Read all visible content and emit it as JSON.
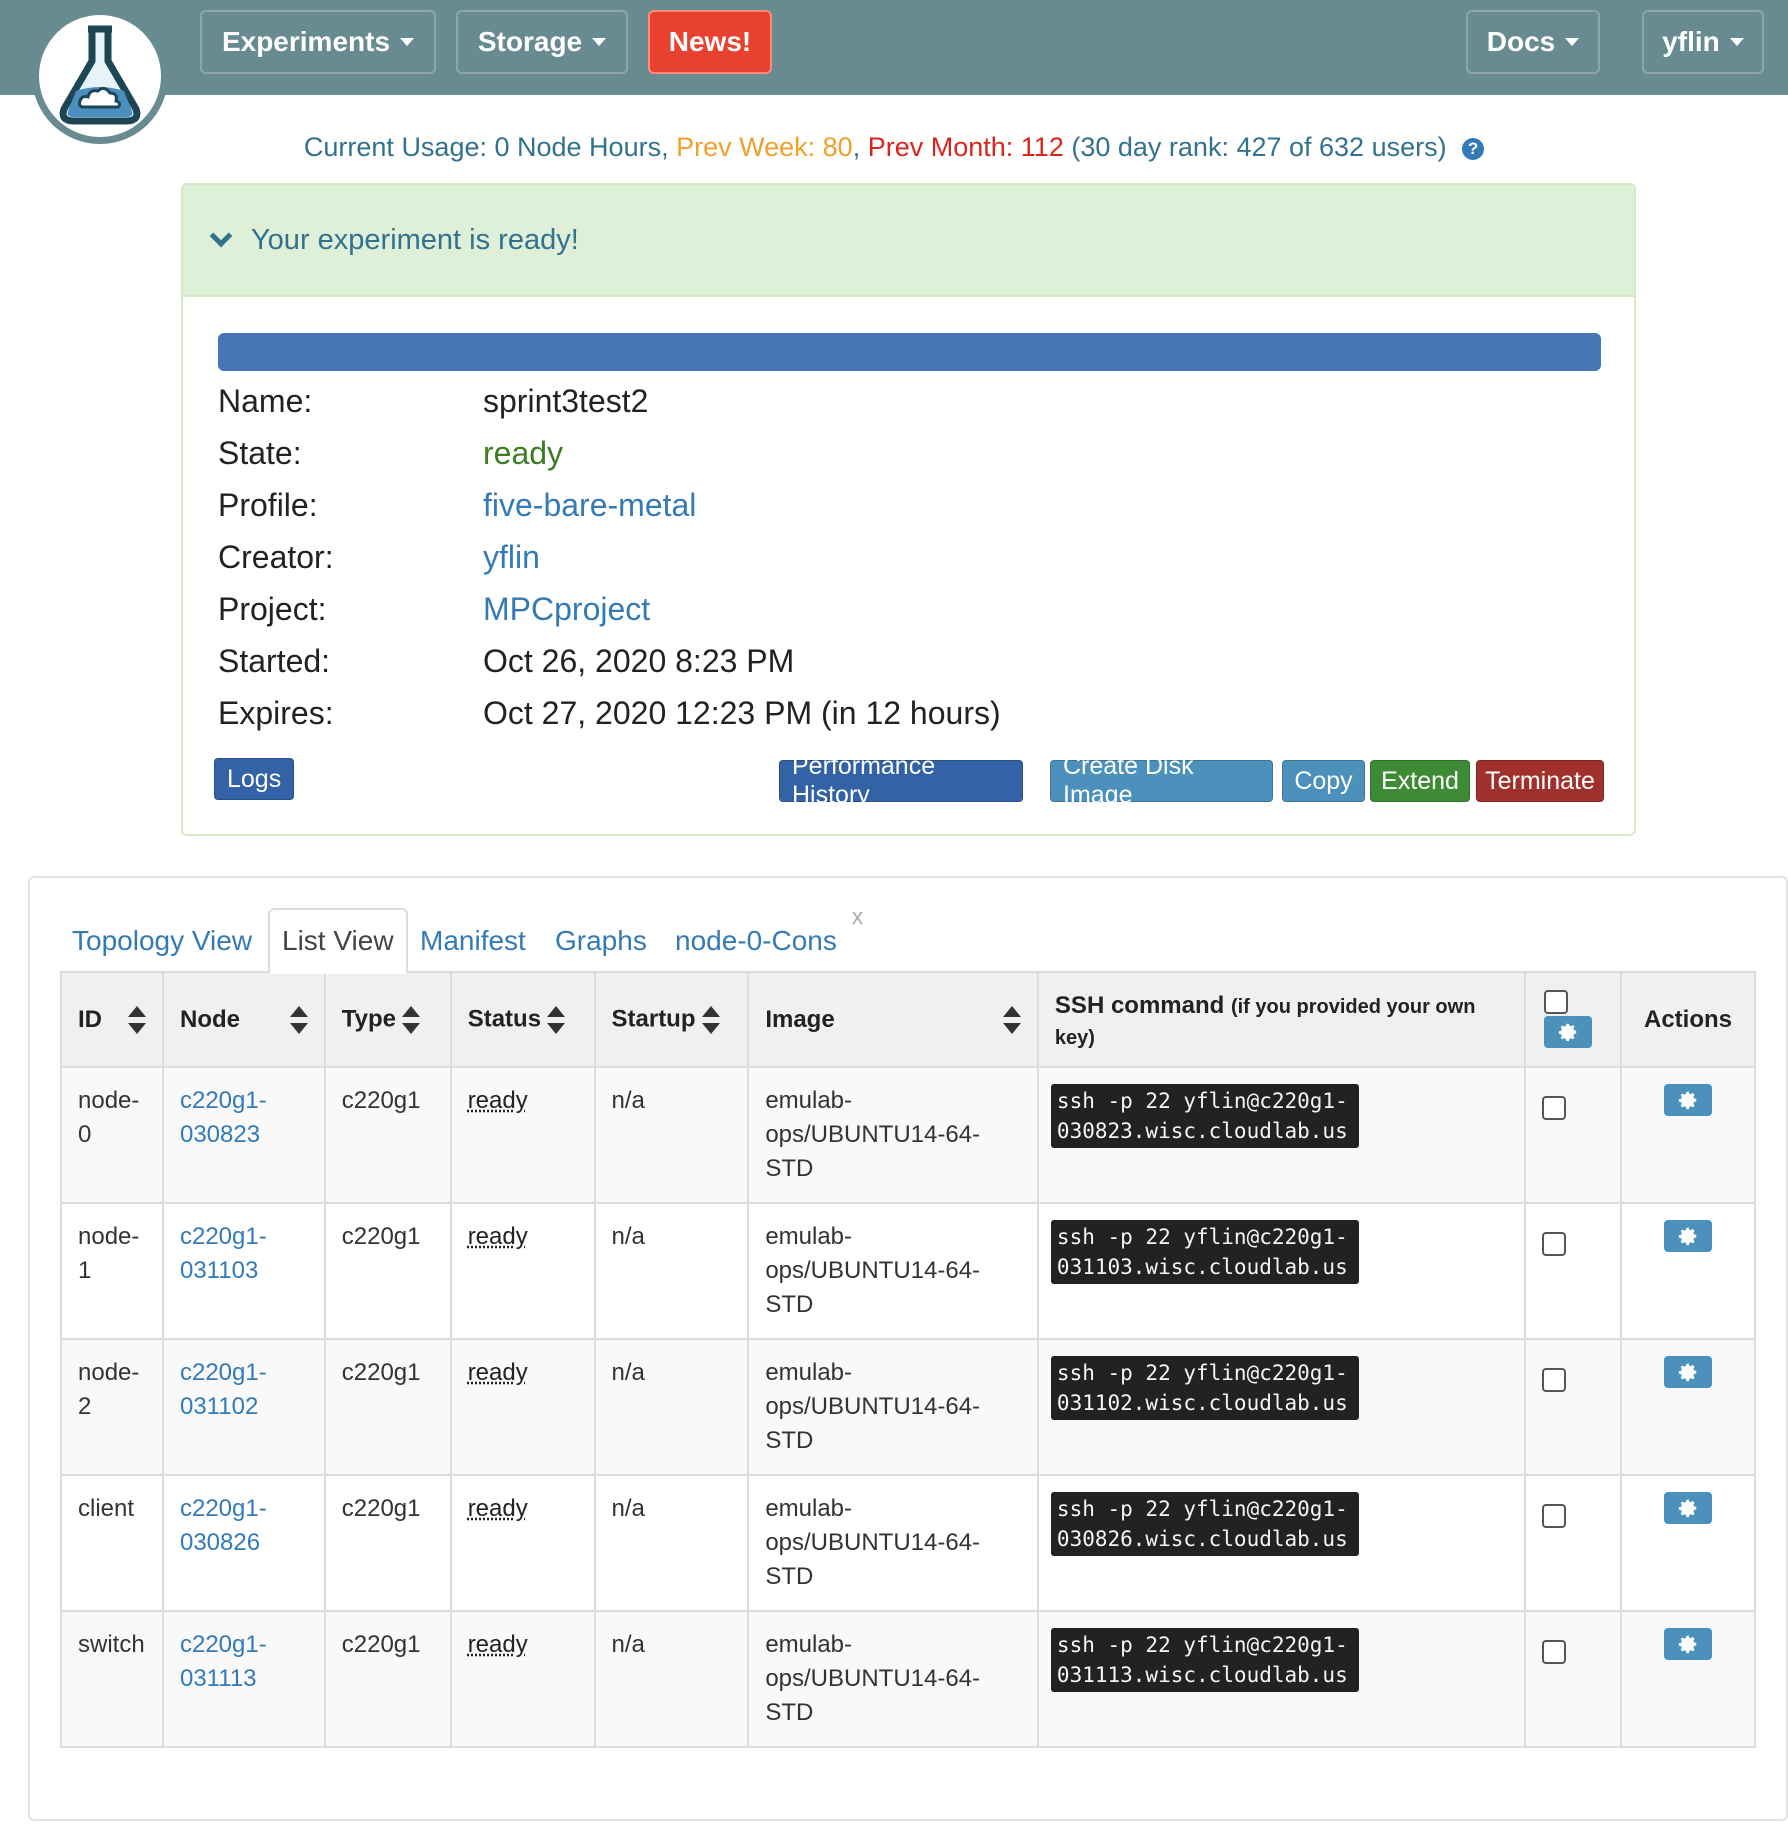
{
  "nav": {
    "experiments": "Experiments",
    "storage": "Storage",
    "news": "News!",
    "docs": "Docs",
    "user": "yflin"
  },
  "usage": {
    "current": "Current Usage: 0 Node Hours",
    "sep1": ",",
    "prev_week": "Prev Week: 80",
    "sep2": ",",
    "prev_month": "Prev Month: 112",
    "rank": "(30 day rank: 427 of 632 users)"
  },
  "panel": {
    "heading": "Your experiment is ready!",
    "progress_percent": 100,
    "fields": [
      {
        "label": "Name:",
        "value": "sprint3test2"
      },
      {
        "label": "State:",
        "value": "ready"
      },
      {
        "label": "Profile:",
        "value": "five-bare-metal"
      },
      {
        "label": "Creator:",
        "value": "yflin"
      },
      {
        "label": "Project:",
        "value": "MPCproject"
      },
      {
        "label": "Started:",
        "value": "Oct 26, 2020 8:23 PM"
      },
      {
        "label": "Expires:",
        "value": "Oct 27, 2020 12:23 PM (in 12 hours)"
      }
    ],
    "buttons": {
      "logs": "Logs",
      "performance": "Performance History",
      "create_disk_image": "Create Disk Image",
      "copy": "Copy",
      "extend": "Extend",
      "terminate": "Terminate"
    }
  },
  "tabs": [
    {
      "label": "Topology View"
    },
    {
      "label": "List View"
    },
    {
      "label": "Manifest"
    },
    {
      "label": "Graphs"
    },
    {
      "label": "node-0-Cons",
      "close": "x"
    }
  ],
  "table": {
    "headers": {
      "id": "ID",
      "node": "Node",
      "type": "Type",
      "status": "Status",
      "startup": "Startup",
      "image": "Image",
      "ssh": "SSH command",
      "ssh_note": "(if you provided your own key)",
      "actions": "Actions"
    },
    "rows": [
      {
        "id": "node-0",
        "node": "c220g1-030823",
        "type": "c220g1",
        "status": "ready",
        "startup": "n/a",
        "image": "emulab-ops/UBUNTU14-64-STD",
        "ssh": "ssh -p 22 yflin@c220g1-030823.wisc.cloudlab.us"
      },
      {
        "id": "node-1",
        "node": "c220g1-031103",
        "type": "c220g1",
        "status": "ready",
        "startup": "n/a",
        "image": "emulab-ops/UBUNTU14-64-STD",
        "ssh": "ssh -p 22 yflin@c220g1-031103.wisc.cloudlab.us"
      },
      {
        "id": "node-2",
        "node": "c220g1-031102",
        "type": "c220g1",
        "status": "ready",
        "startup": "n/a",
        "image": "emulab-ops/UBUNTU14-64-STD",
        "ssh": "ssh -p 22 yflin@c220g1-031102.wisc.cloudlab.us"
      },
      {
        "id": "client",
        "node": "c220g1-030826",
        "type": "c220g1",
        "status": "ready",
        "startup": "n/a",
        "image": "emulab-ops/UBUNTU14-64-STD",
        "ssh": "ssh -p 22 yflin@c220g1-030826.wisc.cloudlab.us"
      },
      {
        "id": "switch",
        "node": "c220g1-031113",
        "type": "c220g1",
        "status": "ready",
        "startup": "n/a",
        "image": "emulab-ops/UBUNTU14-64-STD",
        "ssh": "ssh -p 22 yflin@c220g1-031113.wisc.cloudlab.us"
      }
    ]
  },
  "colors": {
    "nav_bg": "#688b91",
    "news_bg": "#e8412f",
    "link": "#337ab7",
    "ready_green": "#3a7d22",
    "prev_week": "#f0a02a",
    "prev_month": "#d9261c",
    "progress": "#4676b5"
  }
}
